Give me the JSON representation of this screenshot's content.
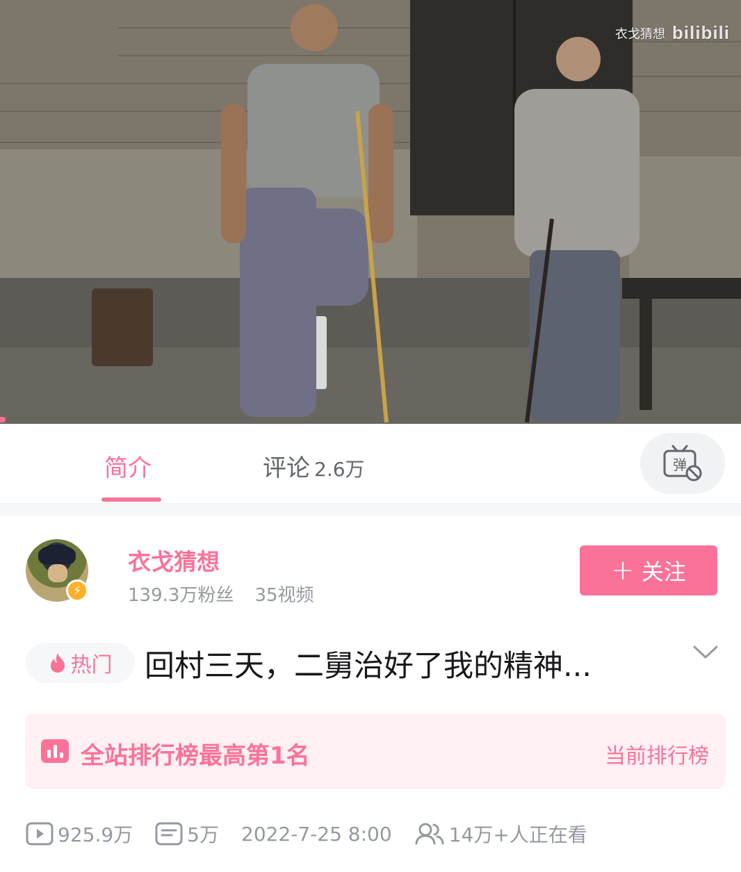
{
  "video": {
    "watermark_name": "衣戈猜想",
    "watermark_brand": "bilibili"
  },
  "tabs": [
    {
      "label": "简介",
      "active": true
    },
    {
      "label": "评论",
      "count": "2.6万",
      "active": false
    }
  ],
  "danmaku_button": {
    "label": "弹"
  },
  "uploader": {
    "name": "衣戈猜想",
    "fans": "139.3万粉丝",
    "videos": "35视频",
    "follow_label": "关注"
  },
  "video_info": {
    "hot_tag": "热门",
    "title": "回村三天，二舅治好了我的精神..."
  },
  "ranking": {
    "text": "全站排行榜最高第1名",
    "link": "当前排行榜"
  },
  "stats": {
    "plays": "925.9万",
    "danmaku": "5万",
    "date": "2022-7-25 8:00",
    "watching": "14万+人正在看"
  },
  "colors": {
    "accent": "#fb7299",
    "text_primary": "#18191c",
    "text_secondary": "#9499a0",
    "banner_bg": "#fff0f3",
    "badge": "#ffb027"
  }
}
